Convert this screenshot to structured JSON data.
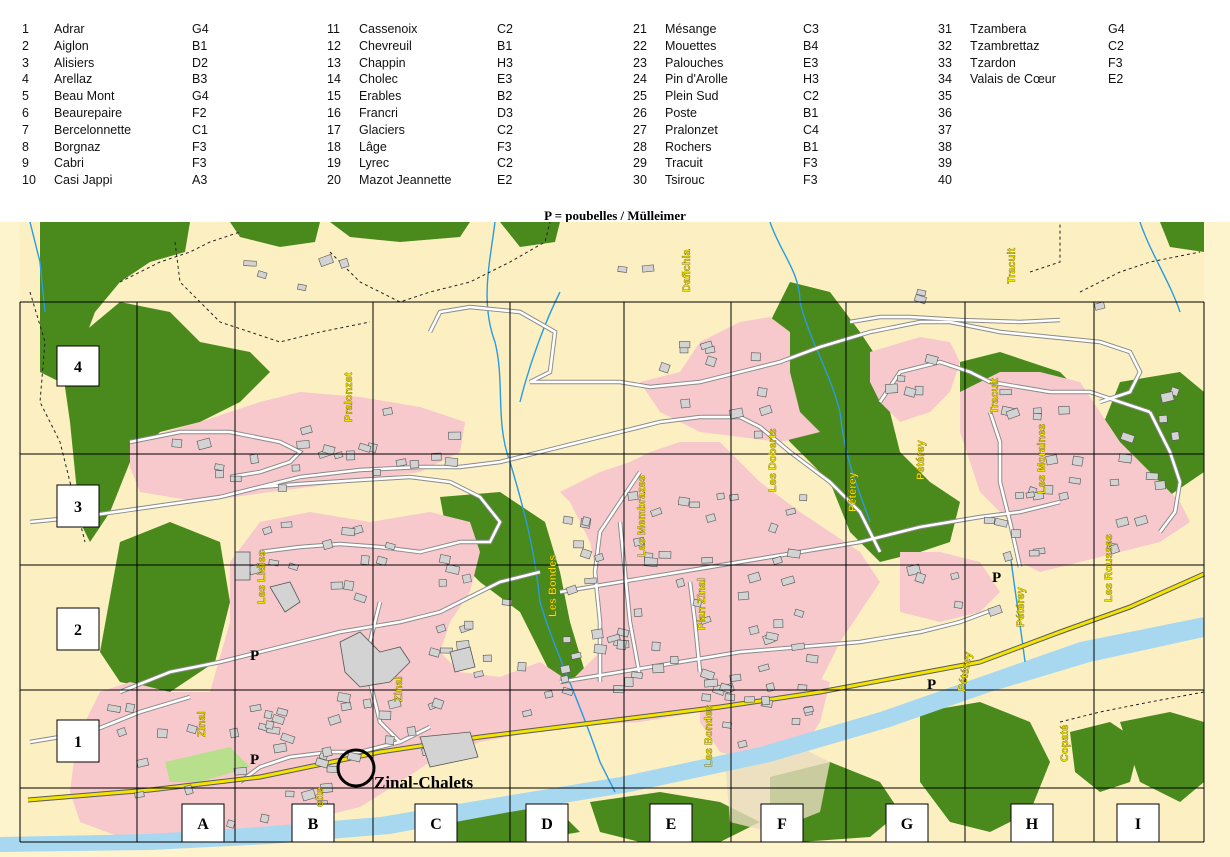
{
  "legend": {
    "columns": [
      [
        {
          "n": "1",
          "name": "Adrar",
          "grid": "G4"
        },
        {
          "n": "2",
          "name": "Aiglon",
          "grid": "B1"
        },
        {
          "n": "3",
          "name": "Alisiers",
          "grid": "D2"
        },
        {
          "n": "4",
          "name": "Arellaz",
          "grid": "B3"
        },
        {
          "n": "5",
          "name": "Beau Mont",
          "grid": "G4"
        },
        {
          "n": "6",
          "name": "Beaurepaire",
          "grid": "F2"
        },
        {
          "n": "7",
          "name": "Bercelonnette",
          "grid": "C1"
        },
        {
          "n": "8",
          "name": "Borgnaz",
          "grid": "F3"
        },
        {
          "n": "9",
          "name": "Cabri",
          "grid": "F3"
        },
        {
          "n": "10",
          "name": "Casi Jappi",
          "grid": "A3"
        }
      ],
      [
        {
          "n": "11",
          "name": "Cassenoix",
          "grid": "C2"
        },
        {
          "n": "12",
          "name": "Chevreuil",
          "grid": "B1"
        },
        {
          "n": "13",
          "name": "Chappin",
          "grid": "H3"
        },
        {
          "n": "14",
          "name": "Cholec",
          "grid": "E3"
        },
        {
          "n": "15",
          "name": "Erables",
          "grid": "B2"
        },
        {
          "n": "16",
          "name": "Francri",
          "grid": "D3"
        },
        {
          "n": "17",
          "name": "Glaciers",
          "grid": "C2"
        },
        {
          "n": "18",
          "name": "Lâge",
          "grid": "F3"
        },
        {
          "n": "19",
          "name": "Lyrec",
          "grid": "C2"
        },
        {
          "n": "20",
          "name": "Mazot Jeannette",
          "grid": "E2"
        }
      ],
      [
        {
          "n": "21",
          "name": "Mésange",
          "grid": "C3"
        },
        {
          "n": "22",
          "name": "Mouettes",
          "grid": "B4"
        },
        {
          "n": "23",
          "name": "Palouches",
          "grid": "E3"
        },
        {
          "n": "24",
          "name": "Pin d'Arolle",
          "grid": "H3"
        },
        {
          "n": "25",
          "name": "Plein Sud",
          "grid": "C2"
        },
        {
          "n": "26",
          "name": "Poste",
          "grid": "B1"
        },
        {
          "n": "27",
          "name": "Pralonzet",
          "grid": "C4"
        },
        {
          "n": "28",
          "name": "Rochers",
          "grid": "B1"
        },
        {
          "n": "29",
          "name": "Tracuit",
          "grid": "F3"
        },
        {
          "n": "30",
          "name": "Tsirouc",
          "grid": "F3"
        }
      ],
      [
        {
          "n": "31",
          "name": "Tzambera",
          "grid": "G4"
        },
        {
          "n": "32",
          "name": "Tzambrettaz",
          "grid": "C2"
        },
        {
          "n": "33",
          "name": "Tzardon",
          "grid": "F3"
        },
        {
          "n": "34",
          "name": "Valais de Cœur",
          "grid": "E2"
        },
        {
          "n": "35",
          "name": "",
          "grid": ""
        },
        {
          "n": "36",
          "name": "",
          "grid": ""
        },
        {
          "n": "37",
          "name": "",
          "grid": ""
        },
        {
          "n": "38",
          "name": "",
          "grid": ""
        },
        {
          "n": "39",
          "name": "",
          "grid": ""
        },
        {
          "n": "40",
          "name": "",
          "grid": ""
        }
      ]
    ]
  },
  "map": {
    "caption": "P = poubelles / Mülleimer",
    "row_labels": [
      "4",
      "3",
      "2",
      "1"
    ],
    "col_labels": [
      "A",
      "B",
      "C",
      "D",
      "E",
      "F",
      "G",
      "H",
      "I"
    ],
    "bin_marker": "P",
    "station_label": "Zinal-Chalets",
    "place_labels": {
      "pralonzet": "Pralonzet",
      "dafichia": "Dafichia",
      "tracuit_top": "Tracuit",
      "tracuit_mid": "Tracuit",
      "les_lidies": "Les Lidies",
      "les_bondes_mid": "Les Bondes",
      "les_bondes_low": "Les Bondes",
      "les_membrazes": "Les Membrazes",
      "plan_zinal": "Plan Zinal",
      "les_doberts": "Les Doberts",
      "peterey_1": "Pétérey",
      "peterey_2": "Pétérey",
      "peterey_3": "Pétérey",
      "peterey_4": "Pétérey",
      "les_moraines": "Les Moraines",
      "les_rousses": "Les Rousses",
      "zinal_1": "Zinal",
      "zinal_2": "Zinal",
      "ette": "ette",
      "copate": "Copaté"
    },
    "colors": {
      "background": "#fdf3cc",
      "forest": "#4a8a1c",
      "built_area": "#f7c8cc",
      "river": "#a8d8f0",
      "stream": "#2a9be0",
      "main_road": "#f2e400",
      "building": "#d3d3d3",
      "grid": "#000000"
    }
  }
}
